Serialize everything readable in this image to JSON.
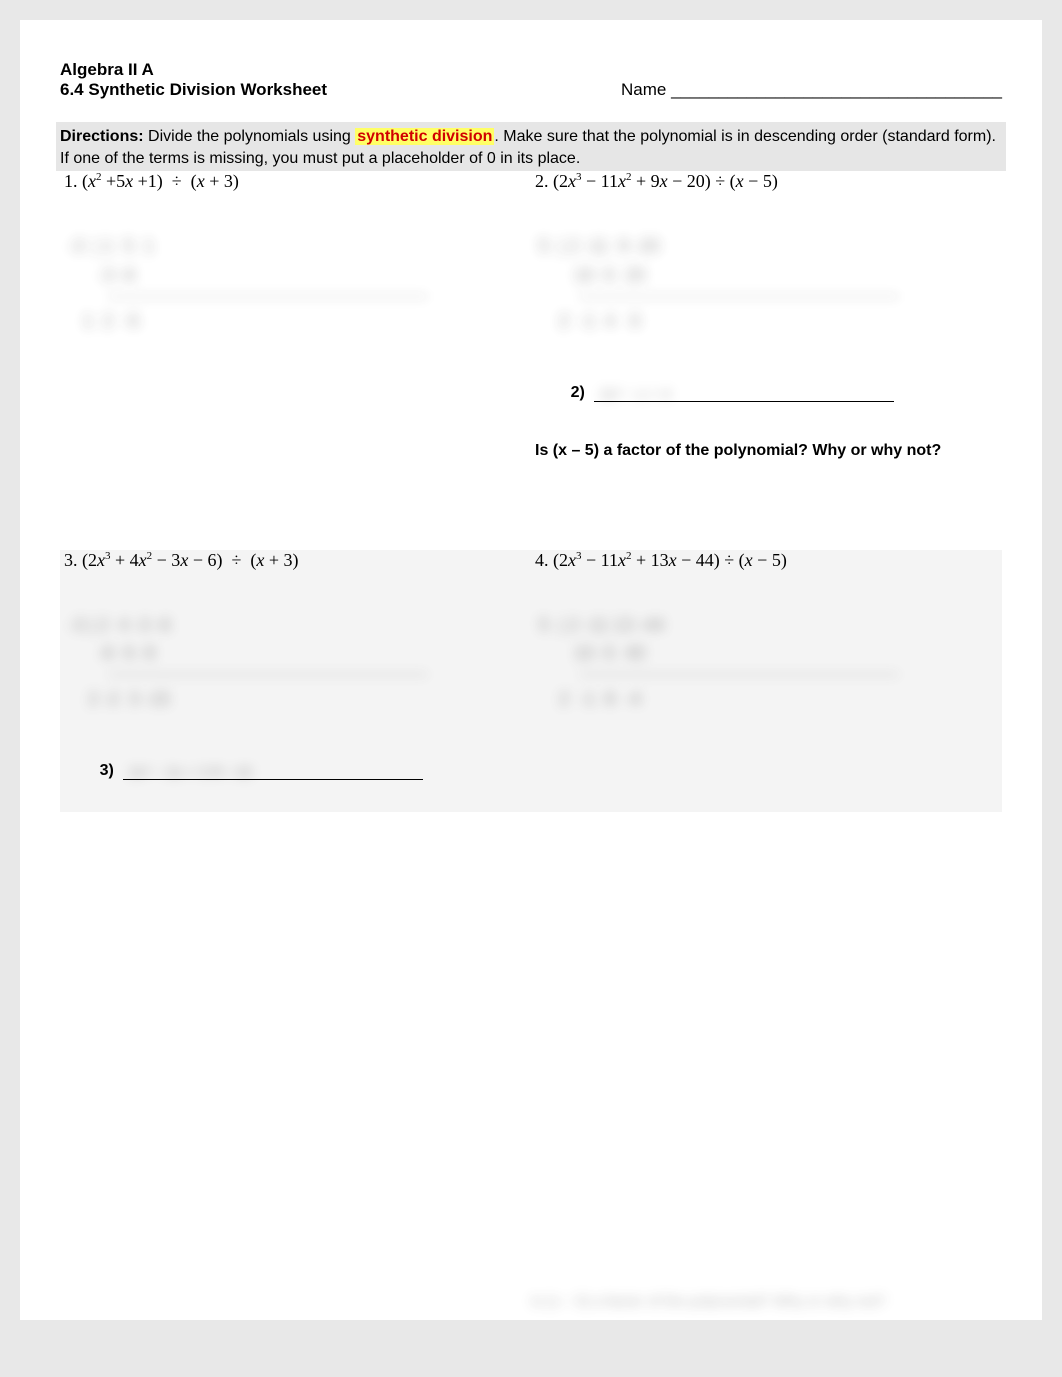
{
  "header": {
    "course": "Algebra II A",
    "title": "6.4 Synthetic Division Worksheet",
    "nameLabel": "Name ___________________________________"
  },
  "directions": {
    "lead": "Directions:",
    "text1": " Divide the polynomials using ",
    "highlight": "synthetic division",
    "text2": ". Make sure that the polynomial is in descending order (standard form). If one of the terms is missing, you must put a placeholder of 0 in its place."
  },
  "problems": {
    "p1": {
      "num": "1.",
      "expr": "(x² + 5x + 1)  ÷  (x + 3)"
    },
    "p2": {
      "num": "2.",
      "expr": "(2x³ − 11x² + 9x − 20) ÷ (x − 5)"
    },
    "p3": {
      "num": "3.",
      "expr": "(2x³ + 4x² − 3x − 6)  ÷  (x + 3)"
    },
    "p4": {
      "num": "4.",
      "expr": "(2x³ − 11x² + 13x − 44) ÷ (x − 5)"
    }
  },
  "answers": {
    "a2": "2)",
    "a3": "3)"
  },
  "factorQ": "Is (x – 5) a factor of the polynomial? Why or why not?",
  "blur": {
    "w1r1": "-3  | 1  5  1",
    "w1r2": "      -3 -6",
    "w1r3": "   1  2  -5",
    "w2r1": "5  | 2 -11  9 -20",
    "w2r2": "       10 -5  20",
    "w2r3": "    2  -1  4   0",
    "w3r1": "-3 | 2  4 -3 -6",
    "w3r2": "      -6  6 -9",
    "w3r3": "    2 -2  3 -15",
    "w4r1": "5  | 2 -11 13 -44",
    "w4r2": "       10 -5  40",
    "w4r3": "    2  -1  8  -4",
    "bb": "Is (x – 5) a factor of the polynomial? Why or why not?"
  }
}
